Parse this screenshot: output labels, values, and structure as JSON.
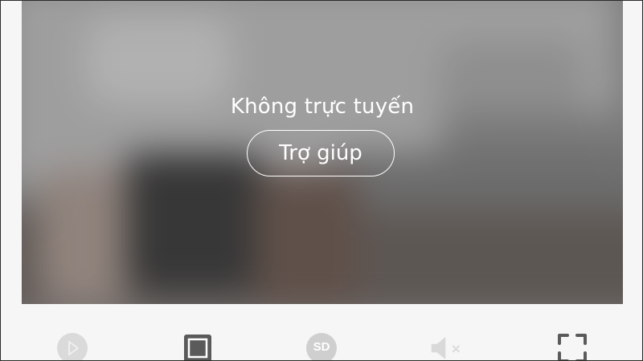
{
  "player": {
    "status_text": "Không trực tuyến",
    "help_label": "Trợ giúp"
  },
  "controls": {
    "play_icon": "play-circle-icon",
    "record_icon": "record-square-icon",
    "quality_label": "SD",
    "mute_icon": "speaker-muted-icon",
    "fullscreen_icon": "fullscreen-icon"
  },
  "colors": {
    "control_light": "#d6d6d6",
    "control_dark": "#5c5c5c",
    "page_bg": "#f6f6f6"
  }
}
